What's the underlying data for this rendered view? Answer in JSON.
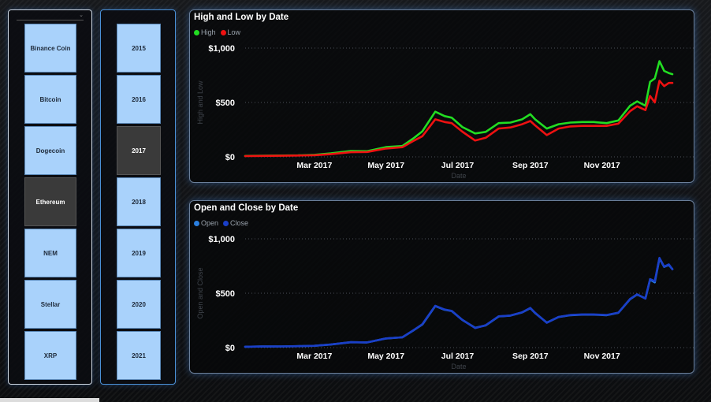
{
  "slicers": {
    "coins": [
      "Binance Coin",
      "Bitcoin",
      "Dogecoin",
      "Ethereum",
      "NEM",
      "Stellar",
      "XRP"
    ],
    "selected_coin": "Ethereum",
    "years": [
      "2015",
      "2016",
      "2017",
      "2018",
      "2019",
      "2020",
      "2021"
    ],
    "selected_year": "2017"
  },
  "colors": {
    "high": "#22dd22",
    "low": "#ee1111",
    "open": "#2a7fe0",
    "close": "#1a3fc8",
    "tile": "#a9d2fb",
    "tile_selected": "#3a3a3a"
  },
  "chart_data": [
    {
      "type": "line",
      "title": "High and Low by Date",
      "xlabel": "Date",
      "ylabel": "High and Low",
      "legend": "top-left",
      "grid": true,
      "ylim": [
        0,
        1000
      ],
      "yticks": [
        0,
        500,
        1000
      ],
      "ytick_labels": [
        "$0",
        "$500",
        "$1,000"
      ],
      "xlim": [
        "2017-01-01",
        "2017-12-31"
      ],
      "xticks": [
        "2017-03-01",
        "2017-05-01",
        "2017-07-01",
        "2017-09-01",
        "2017-11-01"
      ],
      "xtick_labels": [
        "Mar 2017",
        "May 2017",
        "Jul 2017",
        "Sep 2017",
        "Nov 2017"
      ],
      "x": [
        "2017-01-01",
        "2017-01-15",
        "2017-02-01",
        "2017-02-15",
        "2017-03-01",
        "2017-03-15",
        "2017-04-01",
        "2017-04-15",
        "2017-05-01",
        "2017-05-15",
        "2017-05-25",
        "2017-06-01",
        "2017-06-12",
        "2017-06-20",
        "2017-06-26",
        "2017-07-05",
        "2017-07-16",
        "2017-07-25",
        "2017-08-05",
        "2017-08-15",
        "2017-08-25",
        "2017-09-01",
        "2017-09-05",
        "2017-09-15",
        "2017-09-25",
        "2017-10-05",
        "2017-10-15",
        "2017-10-25",
        "2017-11-05",
        "2017-11-15",
        "2017-11-25",
        "2017-12-01",
        "2017-12-08",
        "2017-12-12",
        "2017-12-16",
        "2017-12-20",
        "2017-12-24",
        "2017-12-28",
        "2017-12-31"
      ],
      "series": [
        {
          "name": "High",
          "values": [
            9,
            11,
            12,
            14,
            19,
            32,
            54,
            52,
            90,
            100,
            175,
            235,
            415,
            375,
            360,
            275,
            215,
            230,
            310,
            315,
            345,
            392,
            345,
            260,
            300,
            315,
            320,
            320,
            310,
            335,
            470,
            510,
            470,
            690,
            720,
            880,
            790,
            770,
            760
          ]
        },
        {
          "name": "Low",
          "values": [
            7,
            9,
            10,
            12,
            15,
            25,
            43,
            45,
            77,
            89,
            150,
            190,
            345,
            320,
            310,
            232,
            150,
            175,
            260,
            270,
            300,
            330,
            290,
            200,
            260,
            280,
            285,
            285,
            285,
            305,
            420,
            465,
            430,
            560,
            500,
            700,
            650,
            680,
            680
          ]
        }
      ]
    },
    {
      "type": "line",
      "title": "Open and Close by Date",
      "xlabel": "Date",
      "ylabel": "Open and Close",
      "legend": "top-left",
      "grid": true,
      "ylim": [
        0,
        1000
      ],
      "yticks": [
        0,
        500,
        1000
      ],
      "ytick_labels": [
        "$0",
        "$500",
        "$1,000"
      ],
      "xlim": [
        "2017-01-01",
        "2017-12-31"
      ],
      "xticks": [
        "2017-03-01",
        "2017-05-01",
        "2017-07-01",
        "2017-09-01",
        "2017-11-01"
      ],
      "xtick_labels": [
        "Mar 2017",
        "May 2017",
        "Jul 2017",
        "Sep 2017",
        "Nov 2017"
      ],
      "x": [
        "2017-01-01",
        "2017-01-15",
        "2017-02-01",
        "2017-02-15",
        "2017-03-01",
        "2017-03-15",
        "2017-04-01",
        "2017-04-15",
        "2017-05-01",
        "2017-05-15",
        "2017-05-25",
        "2017-06-01",
        "2017-06-12",
        "2017-06-20",
        "2017-06-26",
        "2017-07-05",
        "2017-07-16",
        "2017-07-25",
        "2017-08-05",
        "2017-08-15",
        "2017-08-25",
        "2017-09-01",
        "2017-09-05",
        "2017-09-15",
        "2017-09-25",
        "2017-10-05",
        "2017-10-15",
        "2017-10-25",
        "2017-11-05",
        "2017-11-15",
        "2017-11-25",
        "2017-12-01",
        "2017-12-08",
        "2017-12-12",
        "2017-12-16",
        "2017-12-20",
        "2017-12-24",
        "2017-12-28",
        "2017-12-31"
      ],
      "series": [
        {
          "name": "Open",
          "values": [
            8,
            10,
            11,
            13,
            17,
            28,
            49,
            48,
            84,
            95,
            162,
            212,
            382,
            348,
            336,
            254,
            182,
            204,
            286,
            294,
            323,
            362,
            318,
            230,
            281,
            298,
            303,
            303,
            298,
            320,
            446,
            488,
            452,
            625,
            600,
            820,
            742,
            760,
            722
          ]
        },
        {
          "name": "Close",
          "values": [
            8,
            10,
            11,
            13,
            17,
            29,
            50,
            48,
            85,
            95,
            164,
            215,
            385,
            350,
            338,
            256,
            180,
            206,
            288,
            295,
            325,
            365,
            320,
            228,
            282,
            300,
            305,
            305,
            300,
            322,
            448,
            490,
            450,
            630,
            610,
            825,
            745,
            765,
            720
          ]
        }
      ]
    }
  ]
}
